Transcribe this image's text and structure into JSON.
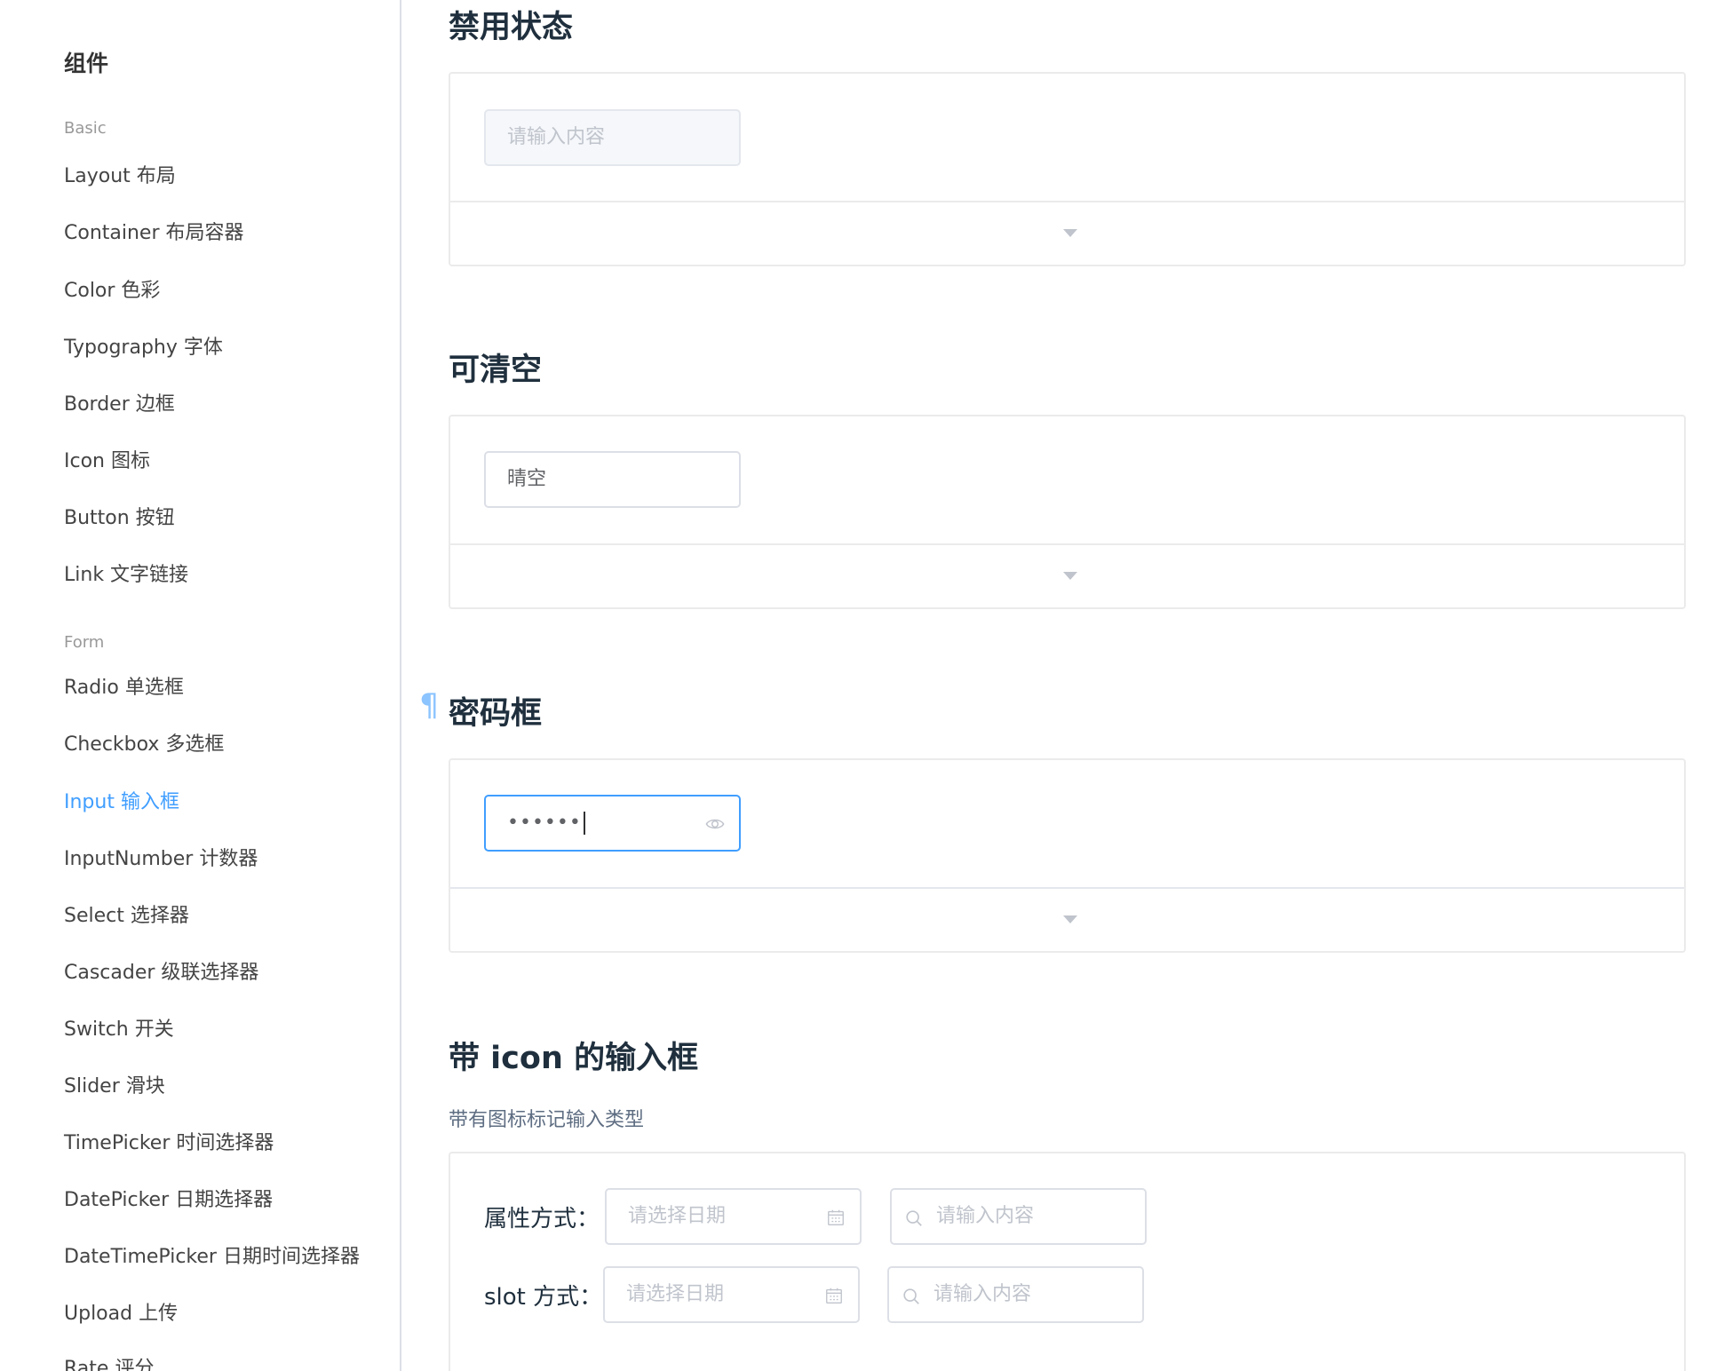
{
  "sidebar": {
    "title": "组件",
    "groups": {
      "basic": "Basic",
      "form": "Form"
    },
    "items": [
      "Layout 布局",
      "Container 布局容器",
      "Color 色彩",
      "Typography 字体",
      "Border 边框",
      "Icon 图标",
      "Button 按钮",
      "Link 文字链接",
      "Radio 单选框",
      "Checkbox 多选框",
      "Input 输入框",
      "InputNumber 计数器",
      "Select 选择器",
      "Cascader 级联选择器",
      "Switch 开关",
      "Slider 滑块",
      "TimePicker 时间选择器",
      "DatePicker 日期选择器",
      "DateTimePicker 日期时间选择器",
      "Upload 上传",
      "Rate 评分"
    ],
    "active_item": "Input 输入框"
  },
  "sections": {
    "disabled": {
      "title": "禁用状态",
      "input_placeholder": "请输入内容"
    },
    "clearable": {
      "title": "可清空",
      "input_value": "晴空"
    },
    "password": {
      "title": "密码框",
      "anchor": "¶",
      "input_value": "••••••"
    },
    "icon_input": {
      "title": "带 icon 的输入框",
      "description": "带有图标标记输入类型",
      "row1_label": "属性方式：",
      "row2_label": "slot 方式：",
      "date_placeholder": "请选择日期",
      "search_placeholder": "请输入内容"
    }
  },
  "colors": {
    "accent": "#409eff",
    "border": "#dcdfe6",
    "placeholder": "#c0c4cc"
  }
}
